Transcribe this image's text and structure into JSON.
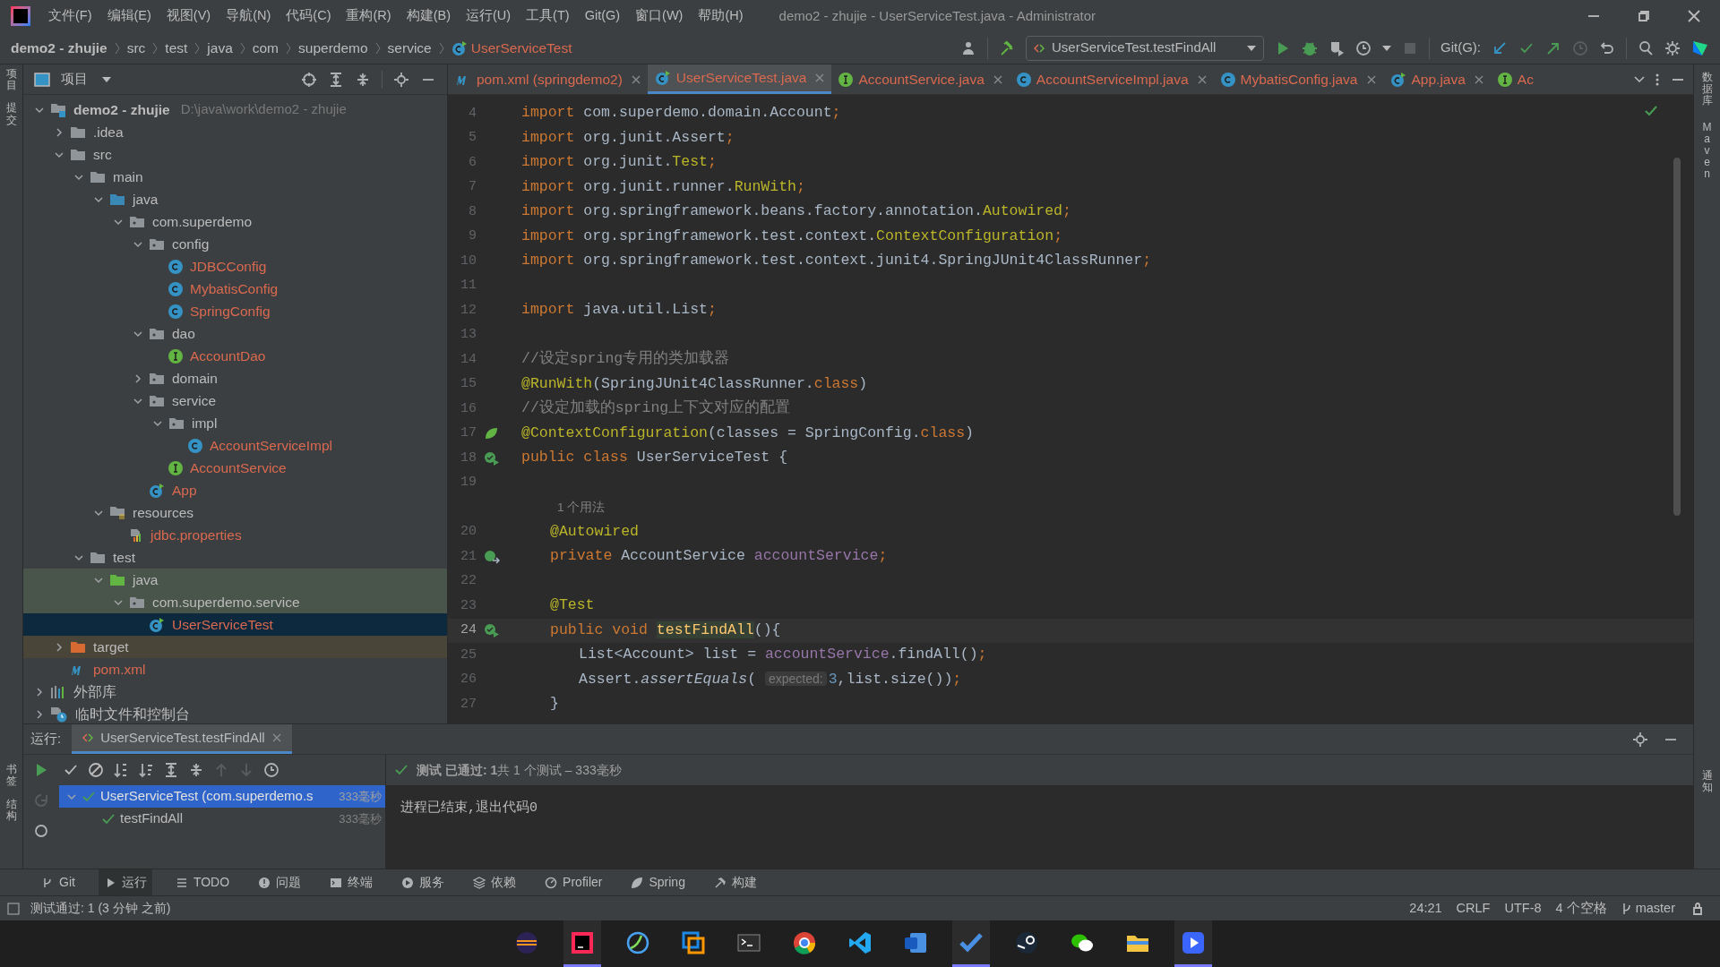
{
  "title_bar": {
    "menus": [
      "文件(F)",
      "编辑(E)",
      "视图(V)",
      "导航(N)",
      "代码(C)",
      "重构(R)",
      "构建(B)",
      "运行(U)",
      "工具(T)",
      "Git(G)",
      "窗口(W)",
      "帮助(H)"
    ],
    "title": "demo2 - zhujie - UserServiceTest.java - Administrator"
  },
  "breadcrumb": [
    {
      "label": "demo2 - zhujie",
      "kind": "project"
    },
    {
      "label": "src",
      "kind": "dir"
    },
    {
      "label": "test",
      "kind": "dir"
    },
    {
      "label": "java",
      "kind": "dir"
    },
    {
      "label": "com",
      "kind": "dir"
    },
    {
      "label": "superdemo",
      "kind": "dir"
    },
    {
      "label": "service",
      "kind": "dir"
    },
    {
      "label": "UserServiceTest",
      "kind": "class"
    }
  ],
  "toolbar": {
    "run_config": "UserServiceTest.testFindAll",
    "git_label": "Git(G):"
  },
  "left_stripe": {
    "top": [
      "项目",
      "提交"
    ],
    "bottom": [
      "书签",
      "结构"
    ]
  },
  "right_stripe": [
    "数据库",
    "Maven",
    "通知"
  ],
  "project_panel": {
    "title": "项目",
    "tree": [
      {
        "name": "demo2 - zhujie",
        "path": "D:\\java\\work\\demo2 - zhujie",
        "kind": "module",
        "expanded": true,
        "selected": false,
        "unversioned": false,
        "test_scope": false,
        "children": [
          {
            "name": ".idea",
            "kind": "folder",
            "expanded": false,
            "selected": false,
            "unversioned": false,
            "test_scope": false
          },
          {
            "name": "src",
            "kind": "folder",
            "expanded": true,
            "selected": false,
            "unversioned": false,
            "test_scope": false,
            "children": [
              {
                "name": "main",
                "kind": "folder",
                "expanded": true,
                "selected": false,
                "unversioned": false,
                "test_scope": false,
                "children": [
                  {
                    "name": "java",
                    "kind": "source",
                    "expanded": true,
                    "selected": false,
                    "unversioned": false,
                    "test_scope": false,
                    "children": [
                      {
                        "name": "com.superdemo",
                        "kind": "package",
                        "expanded": true,
                        "selected": false,
                        "unversioned": false,
                        "test_scope": false,
                        "children": [
                          {
                            "name": "config",
                            "kind": "package",
                            "expanded": true,
                            "selected": false,
                            "unversioned": false,
                            "test_scope": false,
                            "children": [
                              {
                                "name": "JDBCConfig",
                                "kind": "class",
                                "selected": false,
                                "unversioned": true,
                                "test_scope": false
                              },
                              {
                                "name": "MybatisConfig",
                                "kind": "class",
                                "selected": false,
                                "unversioned": true,
                                "test_scope": false
                              },
                              {
                                "name": "SpringConfig",
                                "kind": "class",
                                "selected": false,
                                "unversioned": true,
                                "test_scope": false
                              }
                            ]
                          },
                          {
                            "name": "dao",
                            "kind": "package",
                            "expanded": true,
                            "selected": false,
                            "unversioned": false,
                            "test_scope": false,
                            "children": [
                              {
                                "name": "AccountDao",
                                "kind": "interface",
                                "selected": false,
                                "unversioned": true,
                                "test_scope": false
                              }
                            ]
                          },
                          {
                            "name": "domain",
                            "kind": "package",
                            "expanded": false,
                            "selected": false,
                            "unversioned": false,
                            "test_scope": false
                          },
                          {
                            "name": "service",
                            "kind": "package",
                            "expanded": true,
                            "selected": false,
                            "unversioned": false,
                            "test_scope": false,
                            "children": [
                              {
                                "name": "impl",
                                "kind": "package",
                                "expanded": true,
                                "selected": false,
                                "unversioned": false,
                                "test_scope": false,
                                "children": [
                                  {
                                    "name": "AccountServiceImpl",
                                    "kind": "class",
                                    "selected": false,
                                    "unversioned": true,
                                    "test_scope": false
                                  }
                                ]
                              },
                              {
                                "name": "AccountService",
                                "kind": "interface",
                                "selected": false,
                                "unversioned": true,
                                "test_scope": false
                              }
                            ]
                          },
                          {
                            "name": "App",
                            "kind": "runnable",
                            "selected": false,
                            "unversioned": true,
                            "test_scope": false
                          }
                        ]
                      }
                    ]
                  },
                  {
                    "name": "resources",
                    "kind": "resources",
                    "expanded": true,
                    "selected": false,
                    "unversioned": false,
                    "test_scope": false,
                    "children": [
                      {
                        "name": "jdbc.properties",
                        "kind": "properties",
                        "selected": false,
                        "unversioned": true,
                        "test_scope": false
                      }
                    ]
                  }
                ]
              },
              {
                "name": "test",
                "kind": "folder",
                "expanded": true,
                "selected": false,
                "unversioned": false,
                "test_scope": false,
                "children": [
                  {
                    "name": "java",
                    "kind": "test_source",
                    "expanded": true,
                    "selected": false,
                    "unversioned": false,
                    "test_scope": true,
                    "children": [
                      {
                        "name": "com.superdemo.service",
                        "kind": "package",
                        "expanded": true,
                        "selected": false,
                        "unversioned": false,
                        "test_scope": true,
                        "children": [
                          {
                            "name": "UserServiceTest",
                            "kind": "runnable",
                            "selected": true,
                            "unversioned": true,
                            "test_scope": true
                          }
                        ]
                      }
                    ]
                  }
                ]
              }
            ]
          },
          {
            "name": "target",
            "kind": "excluded",
            "expanded": false,
            "selected": false,
            "unversioned": false,
            "test_scope": false
          },
          {
            "name": "pom.xml",
            "kind": "maven",
            "selected": false,
            "unversioned": true,
            "test_scope": false
          }
        ]
      },
      {
        "name": "外部库",
        "kind": "library",
        "expanded": false,
        "selected": false,
        "unversioned": false,
        "test_scope": false
      },
      {
        "name": "临时文件和控制台",
        "kind": "scratch",
        "expanded": false,
        "selected": false,
        "unversioned": false,
        "test_scope": false
      }
    ]
  },
  "editor_tabs": [
    {
      "label": "pom.xml (springdemo2)",
      "kind": "maven",
      "selected": false
    },
    {
      "label": "UserServiceTest.java",
      "kind": "runnable",
      "selected": true
    },
    {
      "label": "AccountService.java",
      "kind": "interface",
      "selected": false
    },
    {
      "label": "AccountServiceImpl.java",
      "kind": "class",
      "selected": false
    },
    {
      "label": "MybatisConfig.java",
      "kind": "class",
      "selected": false
    },
    {
      "label": "App.java",
      "kind": "runnable",
      "selected": false
    },
    {
      "label": "Ac",
      "kind": "interface",
      "selected": false
    }
  ],
  "editor": {
    "lines": [
      {
        "number": "4",
        "kind": "plain",
        "current": false,
        "in_class": false,
        "in_method": false,
        "tokens": [
          {
            "kind": "keyword",
            "text": "import "
          },
          {
            "kind": "plain",
            "text": "com.superdemo.domain.Account"
          },
          {
            "kind": "keyword",
            "text": ";"
          }
        ]
      },
      {
        "number": "5",
        "kind": "plain",
        "current": false,
        "in_class": false,
        "in_method": false,
        "tokens": [
          {
            "kind": "keyword",
            "text": "import "
          },
          {
            "kind": "plain",
            "text": "org.junit.Assert"
          },
          {
            "kind": "keyword",
            "text": ";"
          }
        ]
      },
      {
        "number": "6",
        "kind": "plain",
        "current": false,
        "in_class": false,
        "in_method": false,
        "tokens": [
          {
            "kind": "keyword",
            "text": "import "
          },
          {
            "kind": "plain",
            "text": "org.junit."
          },
          {
            "kind": "annotation",
            "text": "Test"
          },
          {
            "kind": "keyword",
            "text": ";"
          }
        ]
      },
      {
        "number": "7",
        "kind": "plain",
        "current": false,
        "in_class": false,
        "in_method": false,
        "tokens": [
          {
            "kind": "keyword",
            "text": "import "
          },
          {
            "kind": "plain",
            "text": "org.junit.runner."
          },
          {
            "kind": "annotation",
            "text": "RunWith"
          },
          {
            "kind": "keyword",
            "text": ";"
          }
        ]
      },
      {
        "number": "8",
        "kind": "plain",
        "current": false,
        "in_class": false,
        "in_method": false,
        "tokens": [
          {
            "kind": "keyword",
            "text": "import "
          },
          {
            "kind": "plain",
            "text": "org.springframework.beans.factory.annotation."
          },
          {
            "kind": "annotation",
            "text": "Autowired"
          },
          {
            "kind": "keyword",
            "text": ";"
          }
        ]
      },
      {
        "number": "9",
        "kind": "plain",
        "current": false,
        "in_class": false,
        "in_method": false,
        "tokens": [
          {
            "kind": "keyword",
            "text": "import "
          },
          {
            "kind": "plain",
            "text": "org.springframework.test.context."
          },
          {
            "kind": "annotation",
            "text": "ContextConfiguration"
          },
          {
            "kind": "keyword",
            "text": ";"
          }
        ]
      },
      {
        "number": "10",
        "kind": "plain",
        "current": false,
        "in_class": false,
        "in_method": false,
        "tokens": [
          {
            "kind": "keyword",
            "text": "import "
          },
          {
            "kind": "plain",
            "text": "org.springframework.test.context.junit4.SpringJUnit4ClassRunner"
          },
          {
            "kind": "keyword",
            "text": ";"
          }
        ]
      },
      {
        "number": "11",
        "kind": "plain",
        "current": false
      },
      {
        "number": "12",
        "kind": "plain",
        "current": false,
        "in_class": false,
        "in_method": false,
        "tokens": [
          {
            "kind": "keyword",
            "text": "import "
          },
          {
            "kind": "plain",
            "text": "java.util.List"
          },
          {
            "kind": "keyword",
            "text": ";"
          }
        ]
      },
      {
        "number": "13",
        "kind": "plain",
        "current": false
      },
      {
        "number": "14",
        "kind": "plain",
        "current": false,
        "in_class": false,
        "in_method": false,
        "tokens": [
          {
            "kind": "comment",
            "text": "//设定spring专用的类加载器"
          }
        ]
      },
      {
        "number": "15",
        "kind": "plain",
        "current": false,
        "in_class": false,
        "in_method": false,
        "tokens": [
          {
            "kind": "annotation",
            "text": "@RunWith"
          },
          {
            "kind": "plain",
            "text": "(SpringJUnit4ClassRunner."
          },
          {
            "kind": "keyword",
            "text": "class"
          },
          {
            "kind": "plain",
            "text": ")"
          }
        ]
      },
      {
        "number": "16",
        "kind": "plain",
        "current": false,
        "in_class": false,
        "in_method": false,
        "tokens": [
          {
            "kind": "comment",
            "text": "//设定加载的spring上下文对应的配置"
          }
        ]
      },
      {
        "number": "17",
        "kind": "spring",
        "current": false,
        "in_class": false,
        "in_method": false,
        "tokens": [
          {
            "kind": "annotation",
            "text": "@ContextConfiguration"
          },
          {
            "kind": "plain",
            "text": "(classes = SpringConfig."
          },
          {
            "kind": "keyword",
            "text": "class"
          },
          {
            "kind": "plain",
            "text": ")"
          }
        ]
      },
      {
        "number": "18",
        "kind": "run",
        "current": false,
        "in_class": false,
        "in_method": false,
        "tokens": [
          {
            "kind": "keyword",
            "text": "public class "
          },
          {
            "kind": "plain",
            "text": "UserServiceTest {"
          }
        ]
      },
      {
        "number": "19",
        "kind": "plain",
        "current": false
      },
      {
        "kind": "hint",
        "hint": "1 个用法"
      },
      {
        "number": "20",
        "kind": "plain",
        "current": false,
        "in_class": true,
        "in_method": false,
        "tokens": [
          {
            "kind": "annotation",
            "text": "@Autowired"
          }
        ]
      },
      {
        "number": "21",
        "kind": "injected",
        "current": false,
        "in_class": true,
        "in_method": false,
        "tokens": [
          {
            "kind": "keyword",
            "text": "private "
          },
          {
            "kind": "plain",
            "text": "AccountService "
          },
          {
            "kind": "field",
            "text": "accountService"
          },
          {
            "kind": "keyword",
            "text": ";"
          }
        ]
      },
      {
        "number": "22",
        "kind": "plain",
        "current": false
      },
      {
        "number": "23",
        "kind": "plain",
        "current": false,
        "in_class": true,
        "in_method": false,
        "tokens": [
          {
            "kind": "annotation",
            "text": "@Test"
          }
        ]
      },
      {
        "number": "24",
        "kind": "run",
        "current": true,
        "in_class": true,
        "in_method": false,
        "tokens": [
          {
            "kind": "keyword",
            "text": "public void "
          },
          {
            "kind": "method",
            "text": "testFindAll"
          },
          {
            "kind": "plain",
            "text": "(){"
          }
        ]
      },
      {
        "number": "25",
        "kind": "plain",
        "current": false,
        "in_class": true,
        "in_method": true,
        "tokens": [
          {
            "kind": "plain",
            "text": "List<Account> list = "
          },
          {
            "kind": "field",
            "text": "accountService"
          },
          {
            "kind": "plain",
            "text": ".findAll()"
          },
          {
            "kind": "keyword",
            "text": ";"
          }
        ]
      },
      {
        "number": "26",
        "kind": "plain",
        "current": false,
        "in_class": true,
        "in_method": true,
        "tokens": [
          {
            "kind": "plain",
            "text": "Assert."
          },
          {
            "kind": "italic",
            "text": "assertEquals"
          },
          {
            "kind": "plain",
            "text": "( "
          },
          {
            "kind": "param_hint",
            "text": "expected:"
          },
          {
            "kind": "number",
            "text": "3"
          },
          {
            "kind": "plain",
            "text": ",list.size())"
          },
          {
            "kind": "keyword",
            "text": ";"
          }
        ]
      },
      {
        "number": "27",
        "kind": "plain",
        "current": false,
        "in_class": true,
        "in_method": false,
        "tokens": [
          {
            "kind": "plain",
            "text": "}"
          }
        ]
      }
    ]
  },
  "run_panel": {
    "label": "运行:",
    "tab": "UserServiceTest.testFindAll",
    "status": "**测试 已通过: 1**共 1 个测试 – 333毫秒",
    "tests": [
      {
        "name": "UserServiceTest (com.superdemo.s",
        "time": "333毫秒",
        "passed": true,
        "selected": true,
        "children": [
          {
            "name": "testFindAll",
            "time": "333毫秒",
            "passed": true,
            "selected": false
          }
        ]
      }
    ],
    "console": "进程已结束,退出代码0"
  },
  "tool_tabs": [
    {
      "label": "Git",
      "kind": "git",
      "selected": false
    },
    {
      "label": "运行",
      "kind": "run",
      "selected": true
    },
    {
      "label": "TODO",
      "kind": "list",
      "selected": false
    },
    {
      "label": "问题",
      "kind": "problem",
      "selected": false
    },
    {
      "label": "终端",
      "kind": "terminal",
      "selected": false
    },
    {
      "label": "服务",
      "kind": "services",
      "selected": false
    },
    {
      "label": "依赖",
      "kind": "layers",
      "selected": false
    },
    {
      "label": "Profiler",
      "kind": "profiler",
      "selected": false
    },
    {
      "label": "Spring",
      "kind": "spring",
      "selected": false
    },
    {
      "label": "构建",
      "kind": "hammer",
      "selected": false
    }
  ],
  "status_bar": {
    "message": "测试通过: 1 (3 分钟 之前)",
    "items": [
      "24:21",
      "CRLF",
      "UTF-8",
      "4 个空格"
    ],
    "branch": "master"
  },
  "taskbar": [
    {
      "kind": "eclipse",
      "running": false
    },
    {
      "kind": "intellij",
      "running": true
    },
    {
      "kind": "browser",
      "running": false
    },
    {
      "kind": "window",
      "running": false
    },
    {
      "kind": "terminal",
      "running": false
    },
    {
      "kind": "chrome",
      "running": false
    },
    {
      "kind": "vscode",
      "running": false
    },
    {
      "kind": "word",
      "running": false
    },
    {
      "kind": "todo",
      "running": true
    },
    {
      "kind": "steam",
      "running": false
    },
    {
      "kind": "wechat",
      "running": false
    },
    {
      "kind": "explorer",
      "running": false
    },
    {
      "kind": "player",
      "running": true
    }
  ]
}
